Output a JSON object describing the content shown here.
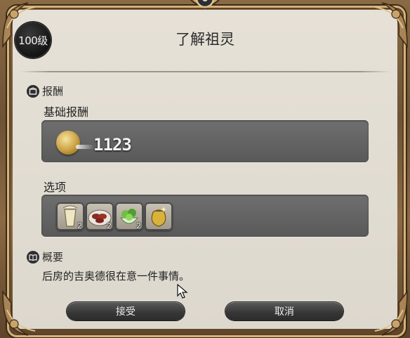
{
  "dialog": {
    "level": "100级",
    "title": "了解祖灵",
    "reward_section": "报酬",
    "base_reward_label": "基础报酬",
    "gil_amount": "1123",
    "options_label": "选项",
    "summary_section": "概要",
    "description": "后房的吉奥德很在意一件事情。",
    "accept_label": "接受",
    "cancel_label": "取消"
  },
  "items": [
    {
      "icon": "drink-icon",
      "qty": "2"
    },
    {
      "icon": "steak-icon",
      "qty": "2"
    },
    {
      "icon": "salad-icon",
      "qty": "2"
    },
    {
      "icon": "herb-pouch-icon",
      "qty": ""
    }
  ],
  "colors": {
    "panel": "#e2ddd3",
    "frame": "#7a5c3a",
    "bar": "#626262",
    "button": "#3a3a3a"
  }
}
